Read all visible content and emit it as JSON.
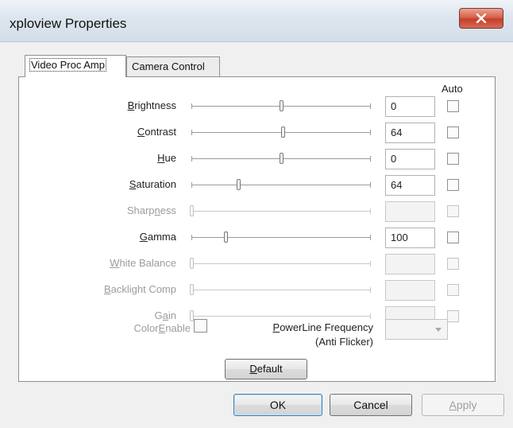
{
  "window": {
    "title": "xploview Properties"
  },
  "tabs": [
    {
      "label": "Video Proc Amp",
      "active": true
    },
    {
      "label": "Camera Control",
      "active": false
    }
  ],
  "auto_header": "Auto",
  "controls": [
    {
      "label_pre": "",
      "label_key": "B",
      "label_post": "rightness",
      "value": "0",
      "level": 0.5,
      "enabled": true
    },
    {
      "label_pre": "",
      "label_key": "C",
      "label_post": "ontrast",
      "value": "64",
      "level": 0.51,
      "enabled": true
    },
    {
      "label_pre": "",
      "label_key": "H",
      "label_post": "ue",
      "value": "0",
      "level": 0.5,
      "enabled": true
    },
    {
      "label_pre": "",
      "label_key": "S",
      "label_post": "aturation",
      "value": "64",
      "level": 0.26,
      "enabled": true
    },
    {
      "label_pre": "Sharp",
      "label_key": "n",
      "label_post": "ess",
      "value": "",
      "level": 0,
      "enabled": false
    },
    {
      "label_pre": "",
      "label_key": "G",
      "label_post": "amma",
      "value": "100",
      "level": 0.19,
      "enabled": true
    },
    {
      "label_pre": "",
      "label_key": "W",
      "label_post": "hite Balance",
      "value": "",
      "level": 0,
      "enabled": false
    },
    {
      "label_pre": "",
      "label_key": "B",
      "label_post": "acklight Comp",
      "value": "",
      "level": 0,
      "enabled": false
    },
    {
      "label_pre": "G",
      "label_key": "a",
      "label_post": "in",
      "value": "",
      "level": 0,
      "enabled": false
    }
  ],
  "color_enable": {
    "label_pre": "Color",
    "label_key": "E",
    "label_post": "nable"
  },
  "powerline": {
    "line1_key": "P",
    "line1_rest": "owerLine Frequency",
    "line2": "(Anti Flicker)",
    "value": ""
  },
  "buttons": {
    "default_key": "D",
    "default_rest": "efault",
    "ok": "OK",
    "cancel": "Cancel",
    "apply_key": "A",
    "apply_rest": "pply"
  }
}
